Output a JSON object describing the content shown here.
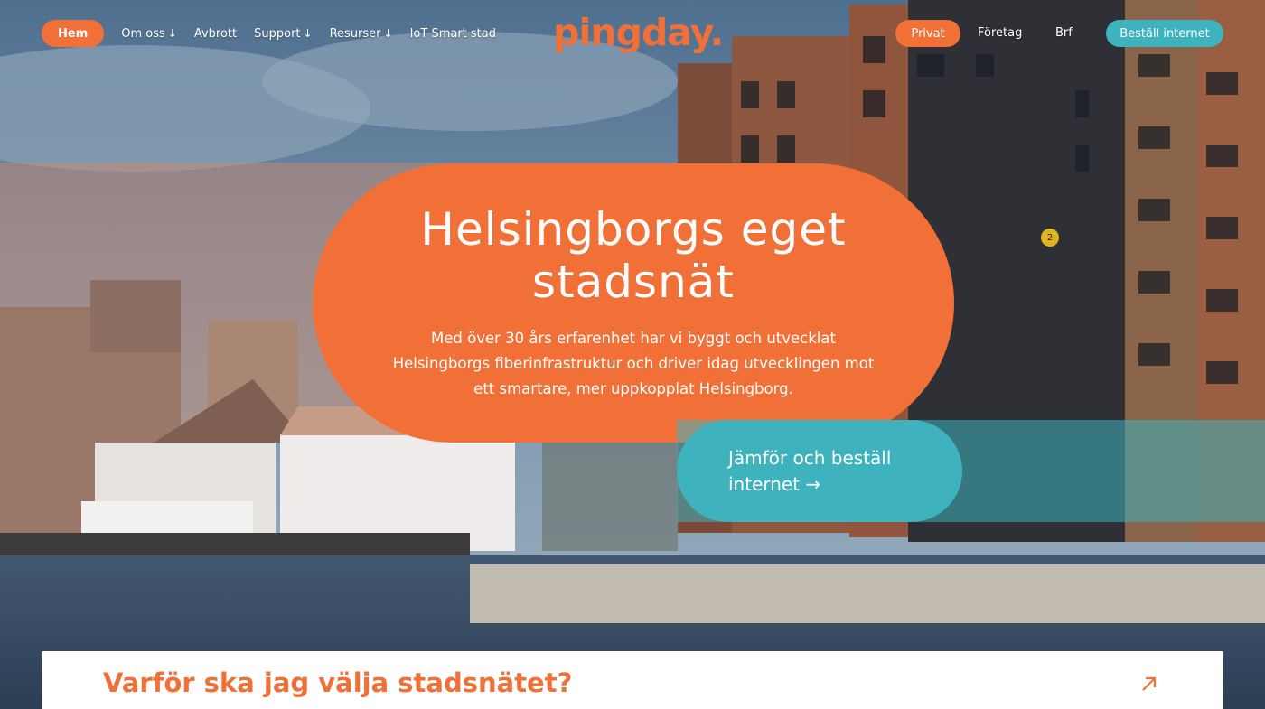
{
  "nav": {
    "home": "Hem",
    "items": [
      {
        "label": "Om oss",
        "arrow": "↓"
      },
      {
        "label": "Avbrott",
        "arrow": ""
      },
      {
        "label": "Support",
        "arrow": "↓"
      },
      {
        "label": "Resurser",
        "arrow": "↓"
      },
      {
        "label": "IoT Smart stad",
        "arrow": ""
      }
    ]
  },
  "logo": "pingday.",
  "segments": {
    "active": "Privat",
    "business": "Företag",
    "brf": "Brf"
  },
  "order_button": "Beställ internet",
  "hero": {
    "title_line1": "Helsingborgs eget",
    "title_line2": "stadsnät",
    "text": "Med över 30 års erfarenhet har vi byggt och utvecklat Helsingborgs fiberinfrastruktur och driver idag utvecklingen mot ett smartare, mer uppkopplat Helsingborg.",
    "cta_line1": "Jämför och beställ",
    "cta_line2": "internet →"
  },
  "badge": "2",
  "bottom": {
    "title": "Varför ska jag välja stadsnätet?"
  },
  "colors": {
    "orange": "#f07037",
    "teal": "#3eb3bd",
    "white": "#ffffff"
  }
}
